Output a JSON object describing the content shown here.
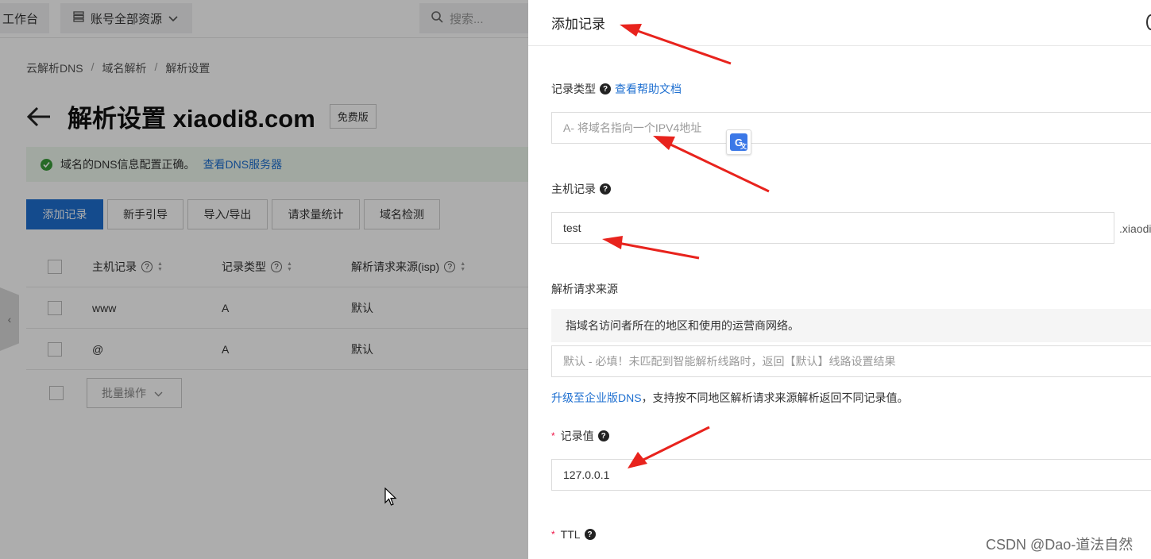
{
  "topbar": {
    "workbench": "工作台",
    "resources": "账号全部资源",
    "search_placeholder": "搜索..."
  },
  "breadcrumb": [
    "云解析DNS",
    "域名解析",
    "解析设置"
  ],
  "breadcrumb_sep": "/",
  "page": {
    "title": "解析设置 xiaodi8.com",
    "badge": "免费版"
  },
  "alert": {
    "text": "域名的DNS信息配置正确。",
    "link": "查看DNS服务器"
  },
  "actions": [
    "添加记录",
    "新手引导",
    "导入/导出",
    "请求量统计",
    "域名检测"
  ],
  "table": {
    "headers": [
      "主机记录",
      "记录类型",
      "解析请求来源(isp)"
    ],
    "rows": [
      {
        "host": "www",
        "type": "A",
        "isp": "默认"
      },
      {
        "host": "@",
        "type": "A",
        "isp": "默认"
      }
    ],
    "batch_label": "批量操作"
  },
  "drawer": {
    "title": "添加记录",
    "record_type_label": "记录类型",
    "help_link": "查看帮助文档",
    "record_type_value": "A- 将域名指向一个IPV4地址",
    "host_label": "主机记录",
    "host_value": "test",
    "host_suffix": ".xiaodi",
    "source_label": "解析请求来源",
    "source_hint": "指域名访问者所在的地区和使用的运营商网络。",
    "source_value": "默认 - 必填！未匹配到智能解析线路时，返回【默认】线路设置结果",
    "upgrade_link": "升级至企业版DNS",
    "upgrade_text": "，支持按不同地区解析请求来源解析返回不同记录值。",
    "value_label": "记录值",
    "value_value": "127.0.0.1",
    "ttl_label": "TTL"
  },
  "required_mark": "*",
  "watermark": "CSDN @Dao-道法自然",
  "colors": {
    "primary": "#1e6fd0",
    "success": "#3a9d3a",
    "annotation_arrow": "#e8231d"
  },
  "icons": [
    "resource-list-icon",
    "chevron-down-icon",
    "search-icon",
    "back-arrow-icon",
    "check-circle-icon",
    "help-icon",
    "sort-icon",
    "translate-icon",
    "mouse-cursor-icon",
    "collapse-tab-icon"
  ]
}
